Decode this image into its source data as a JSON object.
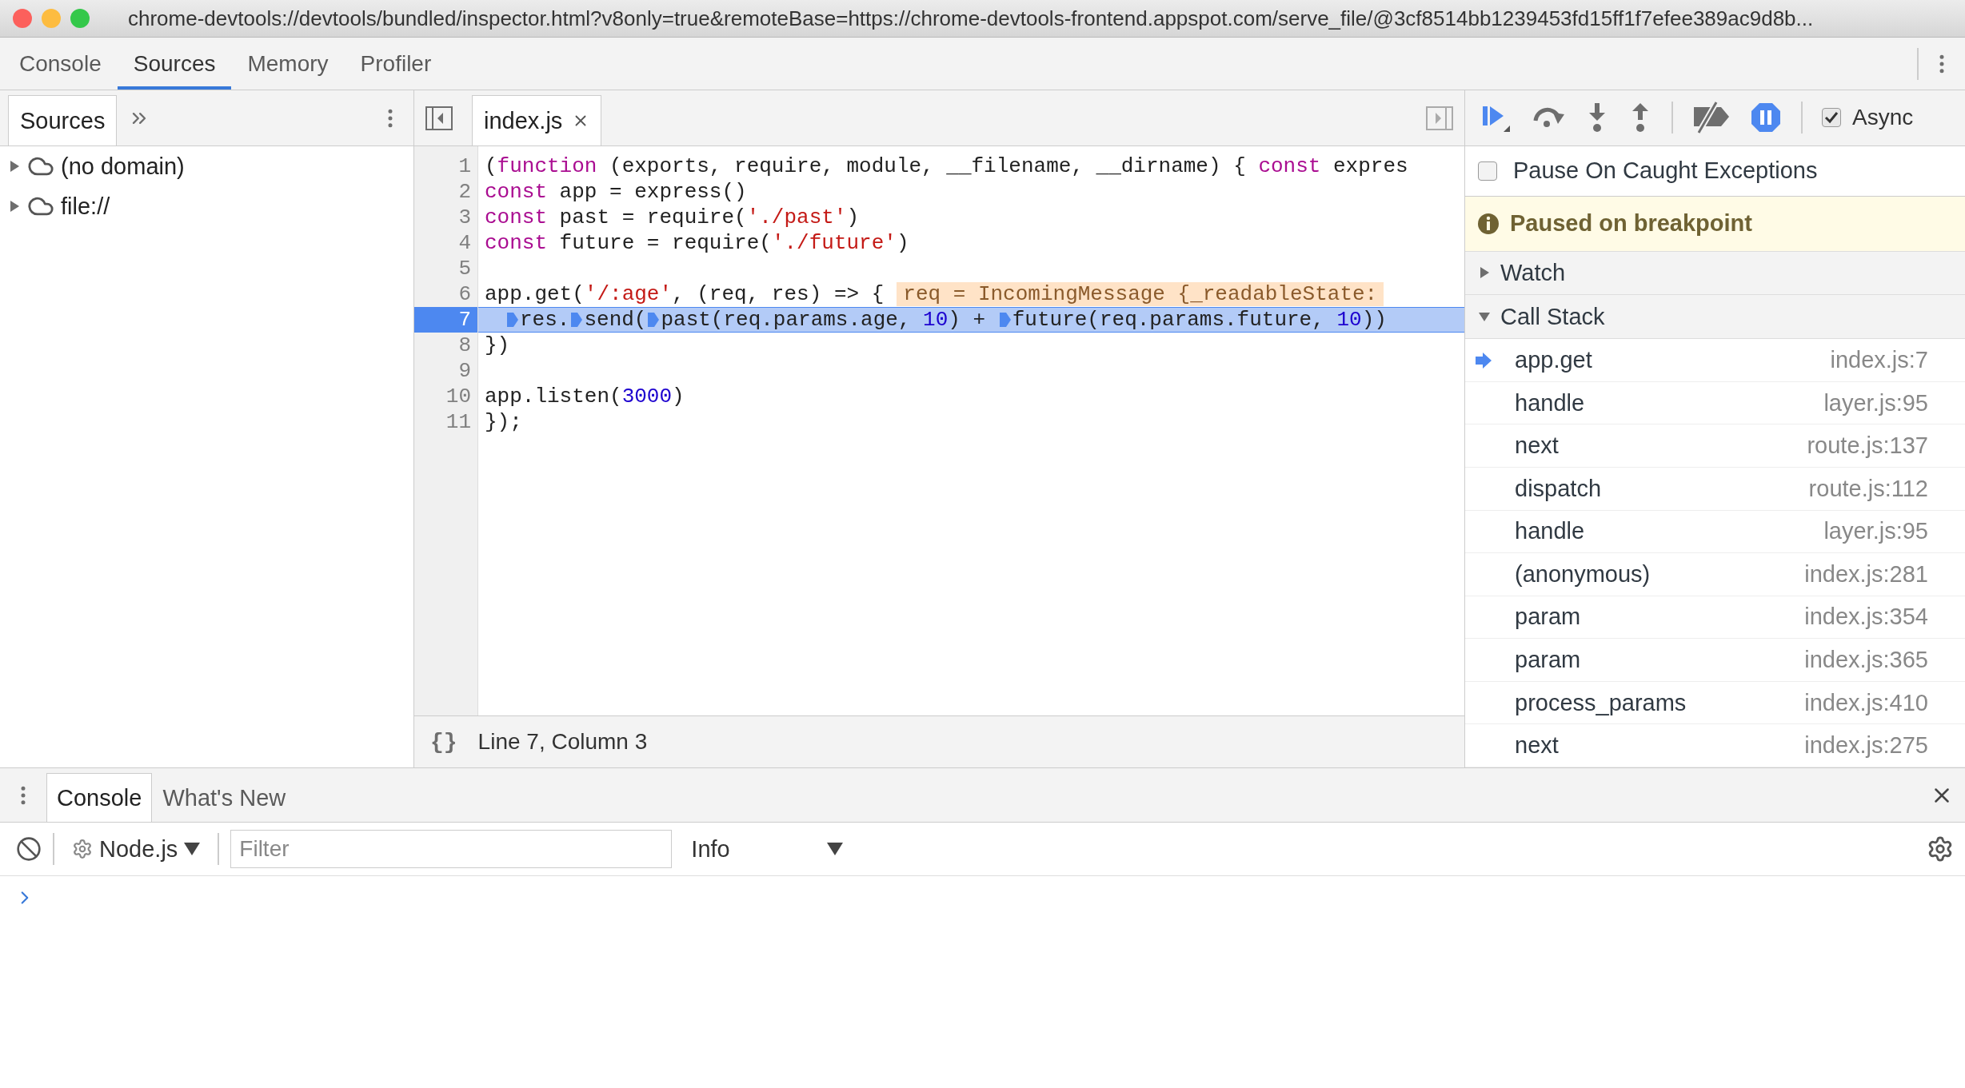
{
  "title_bar": {
    "url": "chrome-devtools://devtools/bundled/inspector.html?v8only=true&remoteBase=https://chrome-devtools-frontend.appspot.com/serve_file/@3cf8514bb1239453fd15ff1f7efee389ac9d8b..."
  },
  "main_tabs": [
    {
      "label": "Console",
      "selected": false
    },
    {
      "label": "Sources",
      "selected": true
    },
    {
      "label": "Memory",
      "selected": false
    },
    {
      "label": "Profiler",
      "selected": false
    }
  ],
  "navigator": {
    "tabs": [
      {
        "label": "Sources",
        "selected": true
      }
    ],
    "tree": [
      {
        "label": "(no domain)",
        "expanded": false
      },
      {
        "label": "file://",
        "expanded": false
      }
    ]
  },
  "editor": {
    "tabs": [
      {
        "label": "index.js",
        "selected": true
      }
    ],
    "lines": [
      {
        "number": "1",
        "current": false,
        "tokens": [
          {
            "kind": "plain",
            "text": "("
          },
          {
            "kind": "keyword",
            "text": "function"
          },
          {
            "kind": "plain",
            "text": " (exports, require, module, __filename, __dirname) { "
          },
          {
            "kind": "keyword",
            "text": "const"
          },
          {
            "kind": "plain",
            "text": " expres"
          }
        ]
      },
      {
        "number": "2",
        "current": false,
        "tokens": [
          {
            "kind": "keyword",
            "text": "const"
          },
          {
            "kind": "plain",
            "text": " app = express()"
          }
        ]
      },
      {
        "number": "3",
        "current": false,
        "tokens": [
          {
            "kind": "keyword",
            "text": "const"
          },
          {
            "kind": "plain",
            "text": " past = require("
          },
          {
            "kind": "string",
            "text": "'./past'"
          },
          {
            "kind": "plain",
            "text": ")"
          }
        ]
      },
      {
        "number": "4",
        "current": false,
        "tokens": [
          {
            "kind": "keyword",
            "text": "const"
          },
          {
            "kind": "plain",
            "text": " future = require("
          },
          {
            "kind": "string",
            "text": "'./future'"
          },
          {
            "kind": "plain",
            "text": ")"
          }
        ]
      },
      {
        "number": "5",
        "current": false
      },
      {
        "number": "6",
        "current": false,
        "tokens": [
          {
            "kind": "plain",
            "text": "app.get("
          },
          {
            "kind": "string",
            "text": "'/:age'"
          },
          {
            "kind": "plain",
            "text": ", (req, res) => {"
          },
          {
            "kind": "inline",
            "text": "req = IncomingMessage {_readableState:"
          }
        ]
      },
      {
        "number": "7",
        "current": true,
        "tokens": [
          {
            "kind": "marker"
          },
          {
            "kind": "plain",
            "text": "res."
          },
          {
            "kind": "marker"
          },
          {
            "kind": "plain",
            "text": "send("
          },
          {
            "kind": "marker"
          },
          {
            "kind": "plain",
            "text": "past(req.params.age, "
          },
          {
            "kind": "number",
            "text": "10"
          },
          {
            "kind": "plain",
            "text": ") + "
          },
          {
            "kind": "marker"
          },
          {
            "kind": "plain",
            "text": "future(req.params.future, "
          },
          {
            "kind": "number",
            "text": "10"
          },
          {
            "kind": "plain",
            "text": "))"
          }
        ]
      },
      {
        "number": "8",
        "current": false,
        "tokens": [
          {
            "kind": "plain",
            "text": "})"
          }
        ]
      },
      {
        "number": "9",
        "current": false
      },
      {
        "number": "10",
        "current": false,
        "tokens": [
          {
            "kind": "plain",
            "text": "app.listen("
          },
          {
            "kind": "number",
            "text": "3000"
          },
          {
            "kind": "plain",
            "text": ")"
          }
        ]
      },
      {
        "number": "11",
        "current": false,
        "tokens": [
          {
            "kind": "plain",
            "text": "});"
          }
        ]
      }
    ],
    "pretty_print": "{}",
    "status": "Line 7, Column 3"
  },
  "debugger": {
    "async": {
      "label": "Async",
      "checked": true
    },
    "pause_on_caught": {
      "label": "Pause On Caught Exceptions",
      "checked": false
    },
    "paused_message": "Paused on breakpoint",
    "sections": [
      {
        "label": "Watch",
        "expanded": false
      },
      {
        "label": "Call Stack",
        "expanded": true
      }
    ],
    "call_stack": [
      {
        "name": "app.get",
        "location": "index.js:7",
        "selected": true
      },
      {
        "name": "handle",
        "location": "layer.js:95",
        "selected": false
      },
      {
        "name": "next",
        "location": "route.js:137",
        "selected": false
      },
      {
        "name": "dispatch",
        "location": "route.js:112",
        "selected": false
      },
      {
        "name": "handle",
        "location": "layer.js:95",
        "selected": false
      },
      {
        "name": "(anonymous)",
        "location": "index.js:281",
        "selected": false
      },
      {
        "name": "param",
        "location": "index.js:354",
        "selected": false
      },
      {
        "name": "param",
        "location": "index.js:365",
        "selected": false
      },
      {
        "name": "process_params",
        "location": "index.js:410",
        "selected": false
      },
      {
        "name": "next",
        "location": "index.js:275",
        "selected": false
      }
    ]
  },
  "drawer": {
    "tabs": [
      {
        "label": "Console",
        "selected": true
      },
      {
        "label": "What's New",
        "selected": false
      }
    ],
    "context": "Node.js",
    "filter": {
      "placeholder": "Filter"
    },
    "level": "Info"
  }
}
